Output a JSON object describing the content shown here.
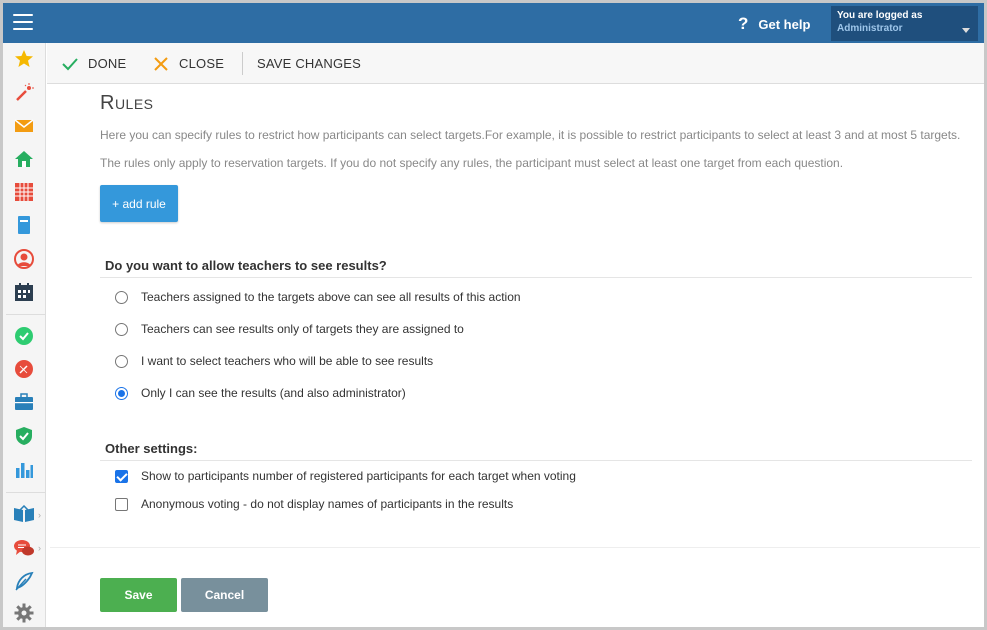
{
  "header": {
    "help_label": "Get help",
    "user_line1": "You are logged as",
    "user_line2": "Administrator"
  },
  "toolbar": {
    "done_label": "DONE",
    "close_label": "CLOSE",
    "save_changes_label": "SAVE CHANGES"
  },
  "sidebar": {
    "items": [
      {
        "icon": "star-icon",
        "color": "#f5b800"
      },
      {
        "icon": "magic-wand-icon",
        "color": "#e74c3c"
      },
      {
        "icon": "envelope-icon",
        "color": "#f39c12"
      },
      {
        "icon": "home-icon",
        "color": "#27ae60"
      },
      {
        "icon": "calendar-grid-icon",
        "color": "#e74c3c"
      },
      {
        "icon": "book-icon",
        "color": "#3498db"
      },
      {
        "icon": "user-circle-icon",
        "color": "#e74c3c"
      },
      {
        "icon": "calendar-icon",
        "color": "#2c3e50"
      },
      {
        "icon": "check-circle-icon",
        "color": "#2ecc71"
      },
      {
        "icon": "pen-circle-icon",
        "color": "#e74c3c"
      },
      {
        "icon": "briefcase-icon",
        "color": "#2980b9"
      },
      {
        "icon": "shield-check-icon",
        "color": "#27ae60"
      },
      {
        "icon": "bar-chart-icon",
        "color": "#3498db"
      },
      {
        "icon": "open-book-icon",
        "color": "#2980b9"
      },
      {
        "icon": "chat-bubbles-icon",
        "color": "#e74c3c"
      },
      {
        "icon": "feather-icon",
        "color": "#2980b9"
      },
      {
        "icon": "gear-icon",
        "color": "#777777"
      }
    ]
  },
  "main": {
    "title": "Rules",
    "desc1": "Here you can specify rules to restrict how participants can select targets.For example, it is possible to restrict participants to select at least 3 and at most 5 targets.",
    "desc2": "The rules only apply to reservation targets. If you do not specify any rules, the participant must select at least one target from each question.",
    "add_rule_label": "+ add rule",
    "results_question": "Do you want to allow teachers to see results?",
    "results_options": [
      {
        "label": "Teachers assigned to the targets above can see all results of this action",
        "selected": false
      },
      {
        "label": "Teachers can see results only of targets they are assigned to",
        "selected": false
      },
      {
        "label": "I want to select teachers who will be able to see results",
        "selected": false
      },
      {
        "label": "Only I can see the results (and also administrator)",
        "selected": true
      }
    ],
    "other_settings_heading": "Other settings:",
    "other_settings": [
      {
        "label": "Show to participants number of registered participants for each target when voting",
        "checked": true
      },
      {
        "label": "Anonymous voting - do not display names of participants in the results",
        "checked": false
      }
    ],
    "save_label": "Save",
    "cancel_label": "Cancel"
  },
  "colors": {
    "header_bg": "#2e6da4",
    "primary_button": "#3498db",
    "save_button": "#4caf50",
    "cancel_button": "#78909c"
  }
}
